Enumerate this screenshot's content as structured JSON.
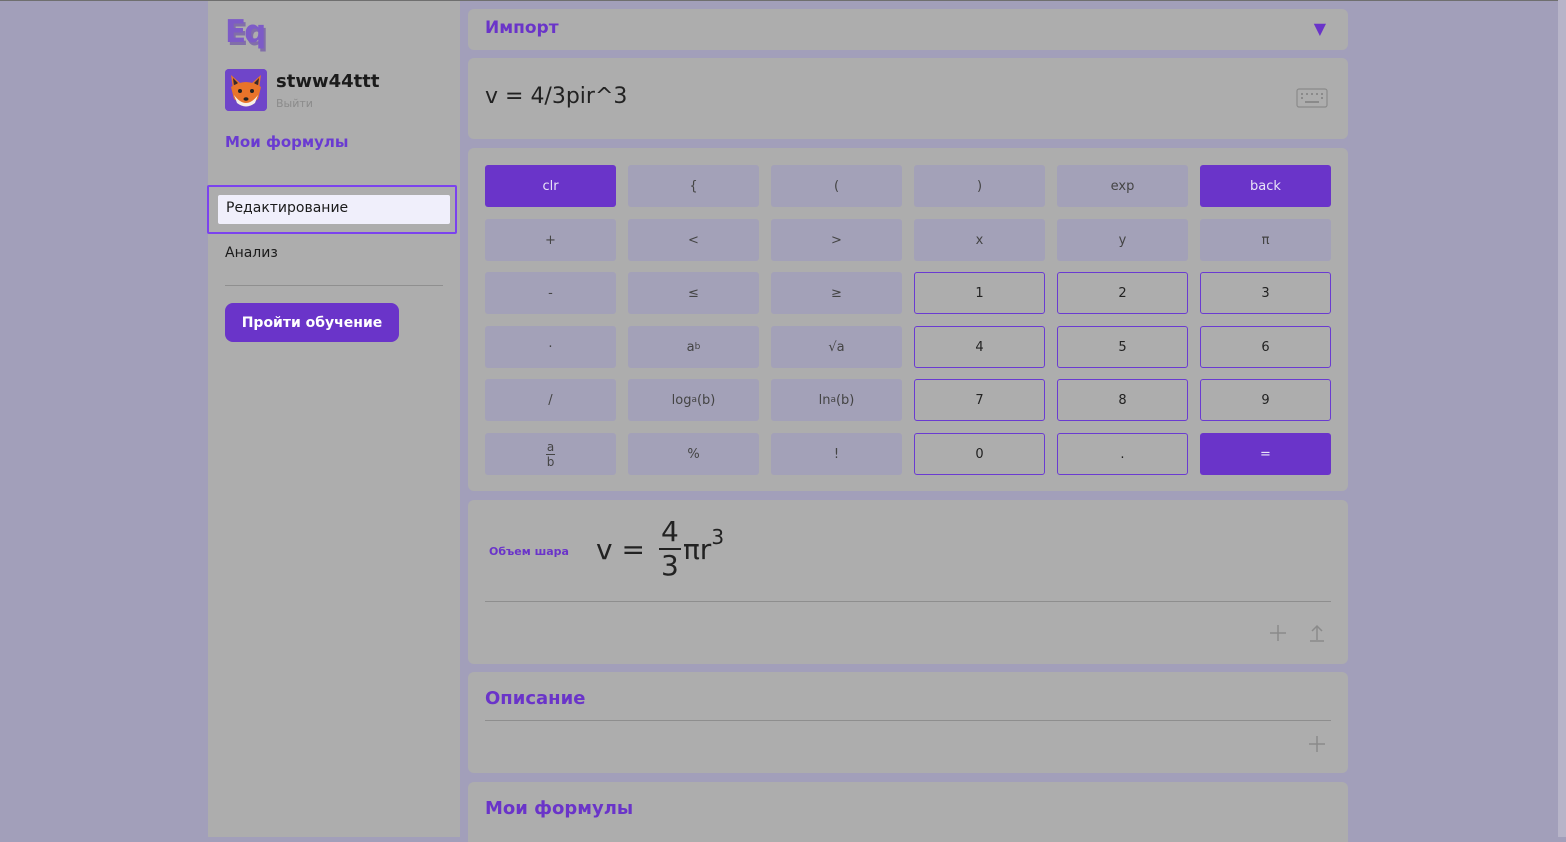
{
  "user": {
    "name": "stww44ttt",
    "logout_label": "Выйти"
  },
  "logo": {
    "text": "Eq"
  },
  "sidebar": {
    "my_formulas_link": "Мои формулы",
    "nav": [
      {
        "label": "Редактирование",
        "active": true
      },
      {
        "label": "Анализ",
        "active": false
      }
    ],
    "tutorial_button": "Пройти обучение"
  },
  "import": {
    "title": "Импорт",
    "toggle_icon": "▼"
  },
  "formula_input": {
    "value": "v = 4/3pir^3"
  },
  "keypad": {
    "row1": [
      "clr",
      "{",
      "(",
      ")",
      "exp",
      "back"
    ],
    "row2": [
      "+",
      "<",
      ">",
      "x",
      "y",
      "π"
    ],
    "row3": [
      "-",
      "≤",
      "≥",
      "1",
      "2",
      "3"
    ],
    "row4": [
      "·",
      "a",
      "b",
      "√a",
      "4",
      "5",
      "6"
    ],
    "row5": [
      "/",
      "log",
      "a",
      "(b)",
      "ln",
      "a",
      "(b)",
      "7",
      "8",
      "9"
    ],
    "row6": [
      "a",
      "b",
      "%",
      "!",
      "0",
      ".",
      "="
    ]
  },
  "result": {
    "label": "Объем шара",
    "lhs": "v =",
    "numerator": "4",
    "denominator": "3",
    "rest": "πr",
    "exponent": "3"
  },
  "description": {
    "title": "Описание"
  },
  "my_formulas": {
    "title": "Мои формулы"
  },
  "colors": {
    "accent": "#6a34c9",
    "background": "#a29fba",
    "panel": "#adadad"
  }
}
